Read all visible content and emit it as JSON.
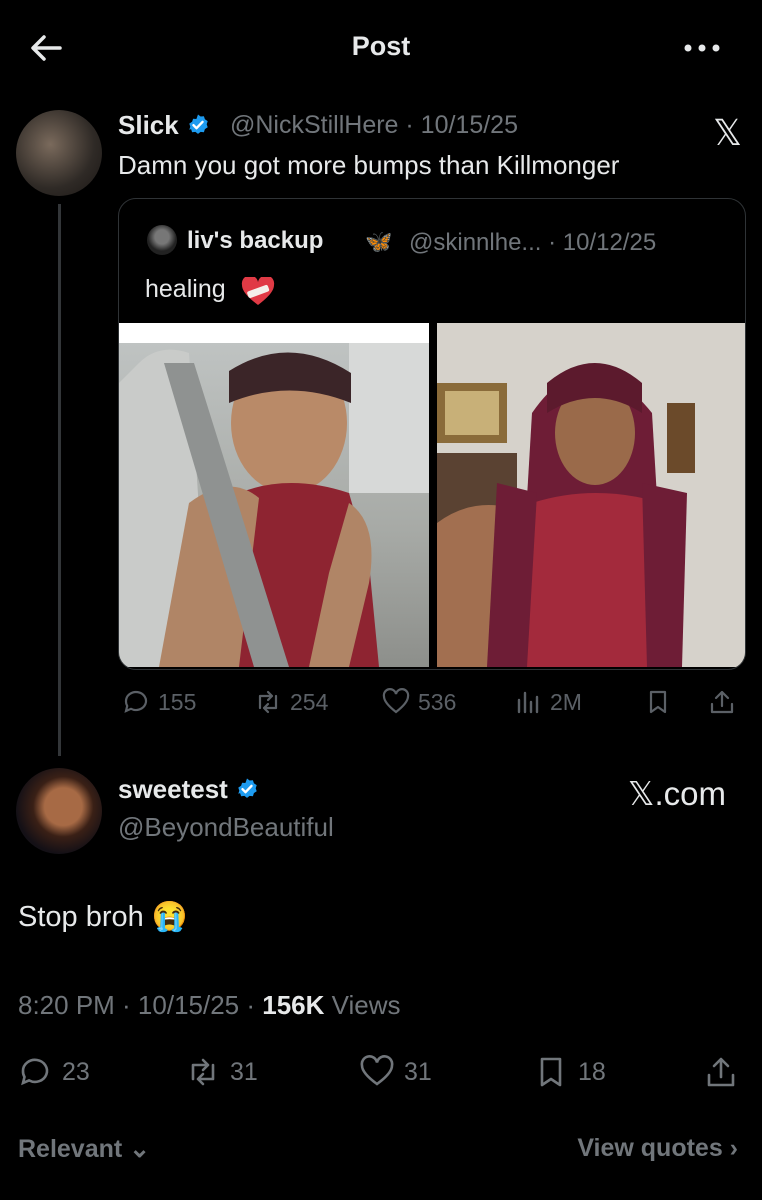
{
  "header": {
    "title": "Post"
  },
  "tweet": {
    "author_name": "Slick",
    "handle_date": "@NickStillHere · 10/15/25",
    "text": "Damn you got more bumps than Killmonger",
    "x_logo": "𝕏"
  },
  "quoted": {
    "author_name": "liv's backup",
    "handle_date": "@skinnlhe... · 10/12/25",
    "text": "healing",
    "stats": {
      "replies": "155",
      "reposts": "254",
      "likes": "536",
      "views": "2M"
    }
  },
  "reply": {
    "author_name": "sweetest",
    "handle": "@BeyondBeautiful",
    "watermark": "𝕏.com",
    "text": "Stop broh",
    "emoji": "😭",
    "meta_prefix": "8:20 PM · 10/15/25 · ",
    "views_count": "156K",
    "views_label": " Views",
    "stats": {
      "replies": "23",
      "reposts": "31",
      "likes": "31",
      "bookmarks": "18"
    }
  },
  "footer": {
    "relevant": "Relevant ⌄",
    "view_quotes": "View quotes ›"
  },
  "colors": {
    "bg": "#000000",
    "text": "#e7e9ea",
    "muted": "#71767b",
    "verified": "#1d9bf0",
    "border": "#2f3336"
  }
}
